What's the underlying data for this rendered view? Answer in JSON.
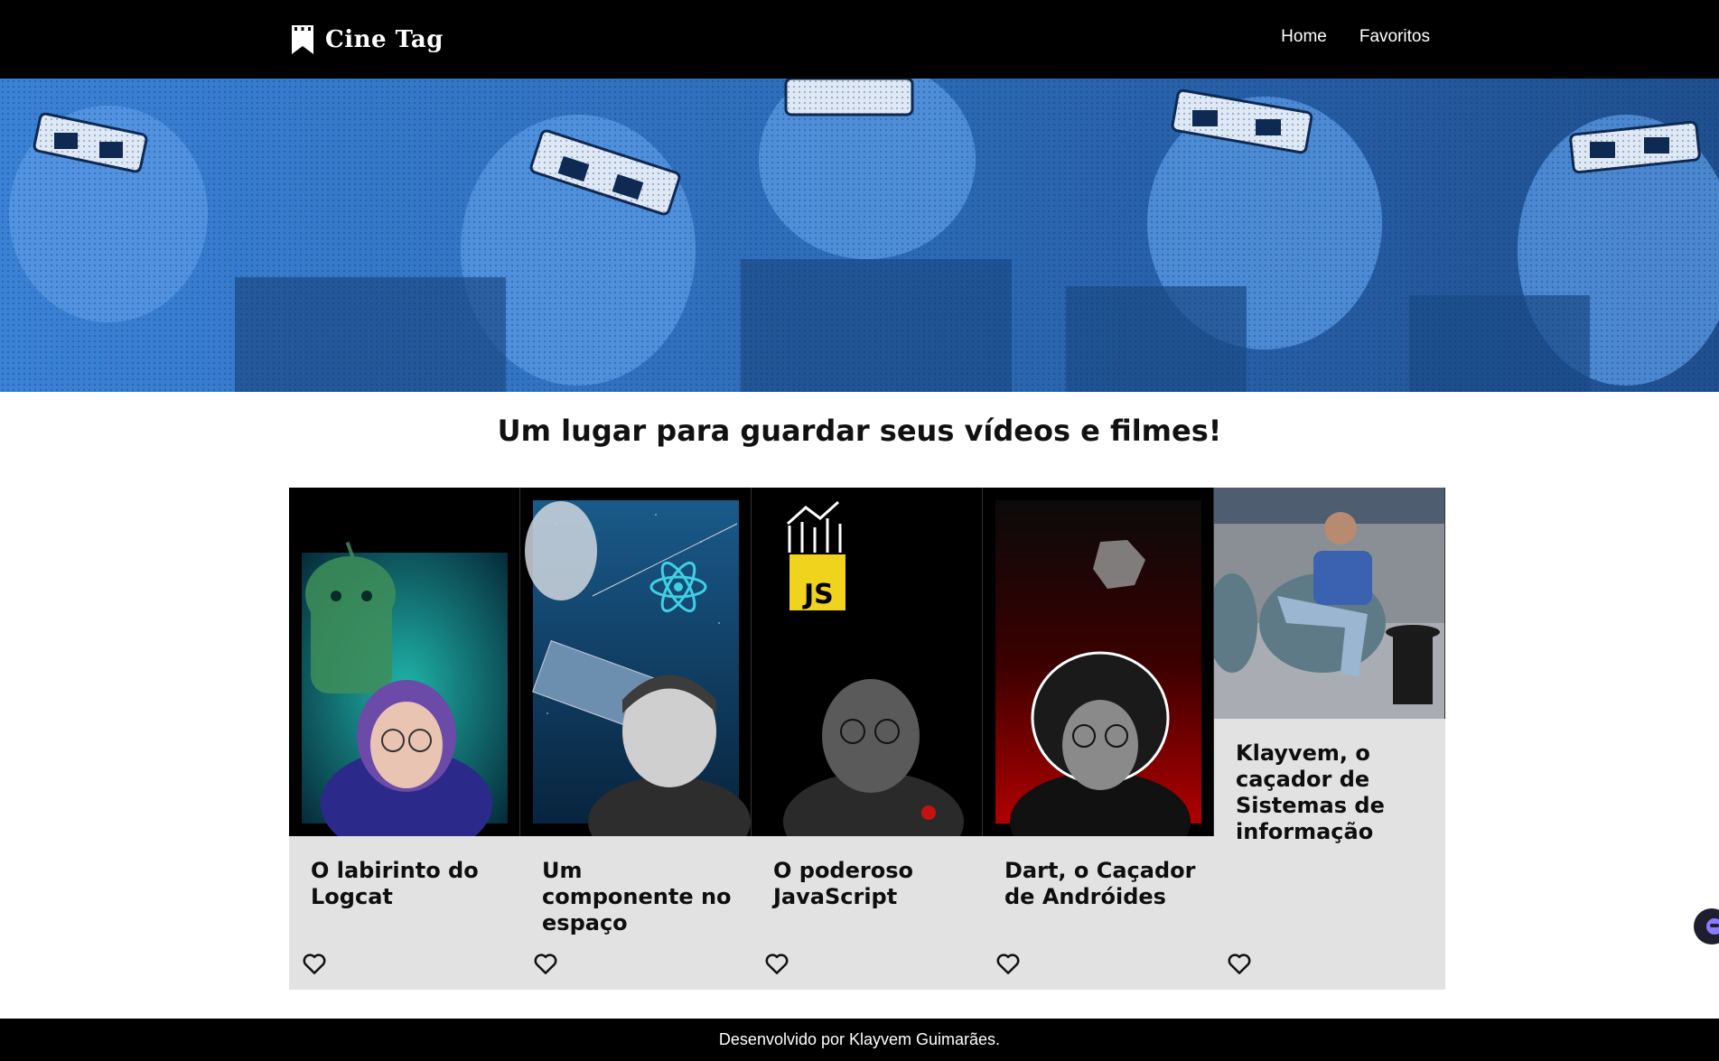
{
  "header": {
    "app_name": "Cine Tag",
    "nav": [
      {
        "label": "Home"
      },
      {
        "label": "Favoritos"
      }
    ]
  },
  "banner": {
    "tint_color": "#2c6fc0"
  },
  "main": {
    "headline": "Um lugar para guardar seus vídeos e filmes!"
  },
  "videos": [
    {
      "title": "O labirinto do Logcat",
      "icon": "heart-outline-icon"
    },
    {
      "title": "Um componente no espaço",
      "icon": "heart-outline-icon"
    },
    {
      "title": "O poderoso JavaScript",
      "icon": "heart-outline-icon"
    },
    {
      "title": "Dart, o Caçador de Andróides",
      "icon": "heart-outline-icon"
    },
    {
      "title": "Klayvem, o caçador de Sistemas de informação",
      "icon": "heart-outline-icon"
    }
  ],
  "thumbnail_badges": {
    "js": "JS"
  },
  "footer": {
    "text": "Desenvolvido por Klayvem Guimarães."
  },
  "colors": {
    "header_bg": "#000000",
    "card_bg": "#e2e2e2",
    "accent_blue": "#2c6fc0"
  }
}
